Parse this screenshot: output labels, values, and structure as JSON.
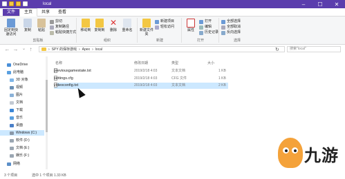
{
  "window": {
    "title": "local"
  },
  "ribbon_tabs": [
    "文件",
    "主页",
    "共享",
    "查看"
  ],
  "ribbon": {
    "clipboard": {
      "group": "剪贴板",
      "pin": "固定到快速访问",
      "copy": "复制",
      "paste": "粘贴",
      "cut": "剪切",
      "copy_path": "复制路径",
      "paste_shortcut": "粘贴快捷方式"
    },
    "organize": {
      "group": "组织",
      "move_to": "移动到",
      "copy_to": "复制到",
      "delete": "删除",
      "rename": "重命名"
    },
    "new": {
      "group": "新建",
      "new_folder": "新建文件夹",
      "new_item": "新建项目",
      "easy_access": "轻松访问"
    },
    "open": {
      "group": "打开",
      "properties": "属性",
      "open": "打开",
      "edit": "编辑",
      "history": "历史记录"
    },
    "select": {
      "group": "选择",
      "select_all": "全部选择",
      "select_none": "全部取消",
      "invert": "反向选择"
    }
  },
  "address": {
    "path": [
      "SPY 的保存游戏",
      "Apex",
      "local"
    ],
    "search_placeholder": "搜索\"local\""
  },
  "nav_items": [
    {
      "label": "OneDrive",
      "icon": "cloud-icon"
    },
    {
      "label": "此电脑",
      "icon": "computer-icon"
    },
    {
      "label": "3D 对象",
      "icon": "cube-icon"
    },
    {
      "label": "视频",
      "icon": "video-icon"
    },
    {
      "label": "图片",
      "icon": "picture-icon"
    },
    {
      "label": "文档",
      "icon": "document-icon"
    },
    {
      "label": "下载",
      "icon": "download-icon"
    },
    {
      "label": "音乐",
      "icon": "music-icon"
    },
    {
      "label": "桌面",
      "icon": "desktop-icon"
    },
    {
      "label": "Windows (C:)",
      "icon": "drive-icon",
      "selected": true
    },
    {
      "label": "软件 (D:)",
      "icon": "drive-icon"
    },
    {
      "label": "文档 (E:)",
      "icon": "drive-icon"
    },
    {
      "label": "娱乐 (F:)",
      "icon": "drive-icon"
    },
    {
      "label": "网络",
      "icon": "network-icon"
    }
  ],
  "columns": {
    "name": "名称",
    "date": "修改日期",
    "type": "类型",
    "size": "大小"
  },
  "files": [
    {
      "name": "previousgamestate.txt",
      "date": "2019/2/18 4:03",
      "type": "文本文档",
      "size": "1 KB"
    },
    {
      "name": "settings.cfg",
      "date": "2019/2/18 4:03",
      "type": "CFG 文件",
      "size": "1 KB"
    },
    {
      "name": "videoconfig.txt",
      "date": "2019/2/18 4:03",
      "type": "文本文档",
      "size": "2 KB",
      "selected": true
    }
  ],
  "status": {
    "count": "3 个项目",
    "selected": "选中 1 个项目  1.33 KB"
  },
  "watermark": {
    "text": "九游"
  }
}
